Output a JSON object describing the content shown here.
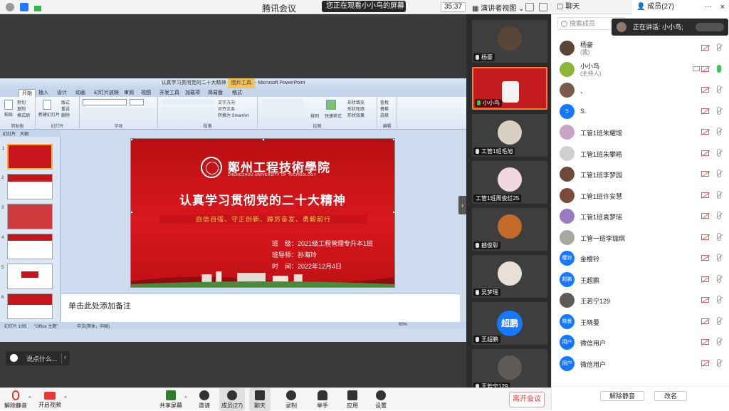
{
  "titlebar": {
    "app_title": "腾讯会议",
    "share_notice": "您正在观看小小鸟的屏幕",
    "timer": "35:37",
    "view_mode": "演讲者视图",
    "chat_tab": "聊天",
    "members_tab": "成员(27)",
    "more": "···",
    "close": "×"
  },
  "ppt": {
    "window_title": "认真学习贯彻党的二十大精神 通用课件(1) - Microsoft PowerPoint",
    "context_tab": "图片工具",
    "tabs": [
      "开始",
      "插入",
      "设计",
      "动画",
      "幻灯片放映",
      "审阅",
      "视图",
      "开发工具",
      "加载项",
      "简易版",
      "格式"
    ],
    "group_labels": [
      "剪贴板",
      "幻灯片",
      "字体",
      "段落",
      "绘图",
      "编辑"
    ],
    "clipboard": {
      "paste": "粘贴",
      "cut": "剪切",
      "copy": "复制",
      "format_painter": "格式刷"
    },
    "slides_group": {
      "new_slide": "新建幻灯片",
      "layout": "版式",
      "reset": "重设",
      "delete": "删除"
    },
    "paragraph_items": [
      "文字方向",
      "对齐文本",
      "转换为 SmartArt"
    ],
    "drawing_items": [
      "排列",
      "快速样式",
      "形状填充",
      "形状轮廓",
      "形状效果"
    ],
    "editing_items": [
      "查找",
      "替换",
      "选择"
    ],
    "panel_tabs": [
      "幻灯片",
      "大纲"
    ],
    "thumb_numbers": [
      "1",
      "2",
      "3",
      "4",
      "5",
      "6"
    ],
    "slide": {
      "school_name": "鄭州工程技術學院",
      "school_en": "ZHENGZHOU UNIVERSITY OF TECHNOLOGY",
      "title": "认真学习贯彻党的二十大精神",
      "subtitle": "自信自强、守正创新、踔厉奋发、勇毅前行",
      "class": "班　级：2021级工程管理专升本1班",
      "advisor": "班导师：孙海玲",
      "date": "时　间：2022年12月4日"
    },
    "notes_placeholder": "单击此处添加备注",
    "status": {
      "slide_count": "幻灯片 1/95",
      "theme": "\"Office 主题\"",
      "lang": "中文(简体，中国)",
      "zoom": "60%"
    }
  },
  "chat_input": {
    "placeholder": "说点什么..."
  },
  "gallery": [
    {
      "name": "杨豪",
      "color": "#5a4636",
      "active": false
    },
    {
      "name": "小小鸟",
      "color": "#c41b1f",
      "active": true
    },
    {
      "name": "工管1班毛旭",
      "color": "#d9cfc4",
      "active": false
    },
    {
      "name": "工管1班周俊红25",
      "color": "#f1d8df",
      "active": false
    },
    {
      "name": "撼俊彰",
      "color": "#c46b2c",
      "active": false
    },
    {
      "name": "吴梦瑶",
      "color": "#e8dfd6",
      "active": false
    },
    {
      "name": "王超鹏",
      "avatar_text": "超鹏",
      "active": false
    },
    {
      "name": "王若宁129",
      "color": "#5e5a56",
      "active": false
    }
  ],
  "members": {
    "search_placeholder": "搜索成员",
    "speaking": "正在讲话: 小小鸟;",
    "list": [
      {
        "name": "杨豪",
        "role": "(我)",
        "color": "#5a4636"
      },
      {
        "name": "小小鸟",
        "role": "(主持人)",
        "color": "#8bb63a",
        "mic_on": true
      },
      {
        "name": "、",
        "color": "#7a5a4a"
      },
      {
        "name": "S.",
        "avatar_text": "S",
        "color": "#1677ff"
      },
      {
        "name": "工管1班朱耀增",
        "color": "#c9a4c4"
      },
      {
        "name": "工管1班朱攀皓",
        "color": "#cfcfcf"
      },
      {
        "name": "工管1班李梦园",
        "color": "#6b4a3a"
      },
      {
        "name": "工管1班许安慧",
        "color": "#7a4a3a"
      },
      {
        "name": "工管1班袁梦瑶",
        "color": "#9a7ac4"
      },
      {
        "name": "工管一班李瑞琪",
        "color": "#a8a8a0"
      },
      {
        "name": "金樱铃",
        "avatar_text": "樱铃",
        "color": "#1677ff"
      },
      {
        "name": "王超鹏",
        "avatar_text": "超鹏",
        "color": "#1677ff"
      },
      {
        "name": "王若宁129",
        "color": "#5e5a56"
      },
      {
        "name": "王晓曼",
        "avatar_text": "晓曼",
        "color": "#1677ff"
      },
      {
        "name": "微信用户",
        "avatar_text": "用户",
        "color": "#1677ff"
      },
      {
        "name": "微信用户",
        "avatar_text": "用户",
        "color": "#1677ff"
      }
    ],
    "mute_all": "解除静音",
    "rename": "改名"
  },
  "toolbar": {
    "unmute": "解除静音",
    "start_video": "开启视频",
    "share_screen": "共享屏幕",
    "invite": "邀请",
    "members": "成员(27)",
    "chat": "聊天",
    "record": "录制",
    "raise_hand": "举手",
    "apps": "应用",
    "settings": "设置",
    "leave": "离开会议"
  }
}
